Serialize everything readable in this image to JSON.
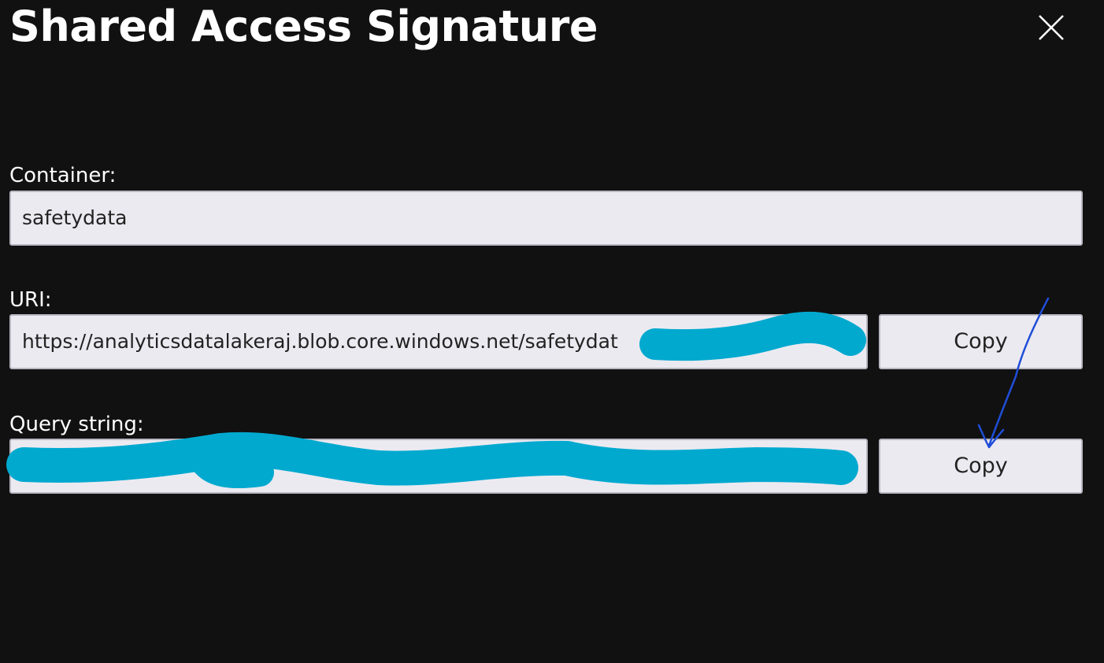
{
  "dialog": {
    "title": "Shared Access Signature",
    "close_icon": "close-icon"
  },
  "fields": {
    "container": {
      "label": "Container:",
      "value": "safetydata"
    },
    "uri": {
      "label": "URI:",
      "value": "https://analyticsdatalakeraj.blob.core.windows.net/safetydat",
      "copy_label": "Copy"
    },
    "query_string": {
      "label": "Query string:",
      "value": "",
      "copy_label": "Copy"
    }
  },
  "annotations": {
    "redaction_color": "#02a9cf",
    "arrow_color": "#1f4ed8"
  },
  "colors": {
    "background": "#111111",
    "field_background": "#eceaf1",
    "field_border": "#b9b7c2",
    "text": "#ffffff"
  }
}
